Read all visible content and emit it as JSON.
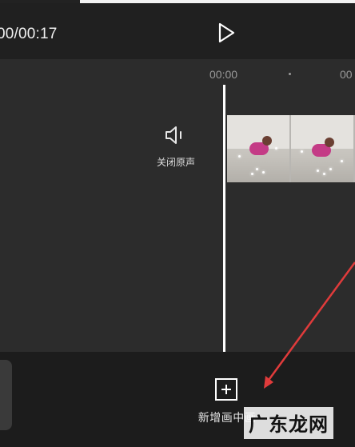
{
  "player": {
    "time_display": "00/00:17",
    "play_icon": "play-icon"
  },
  "timeline": {
    "ruler_labels": [
      "00:00",
      "00"
    ],
    "audio": {
      "mute_label": "关闭原声",
      "mute_icon": "speaker-icon"
    },
    "clip": {
      "frame_count": 2
    }
  },
  "toolbar": {
    "add_picture_label": "新增画中画",
    "add_icon": "plus-square-icon"
  },
  "annotation": {
    "arrow_color": "#e03b3b"
  },
  "watermark": {
    "text": "广东龙网"
  },
  "colors": {
    "background": "#222222",
    "timeline_bg": "#2c2c2c",
    "bottom_bar_bg": "#1c1c1c",
    "playhead": "#ffffff",
    "text_muted": "#9a9a9a"
  }
}
